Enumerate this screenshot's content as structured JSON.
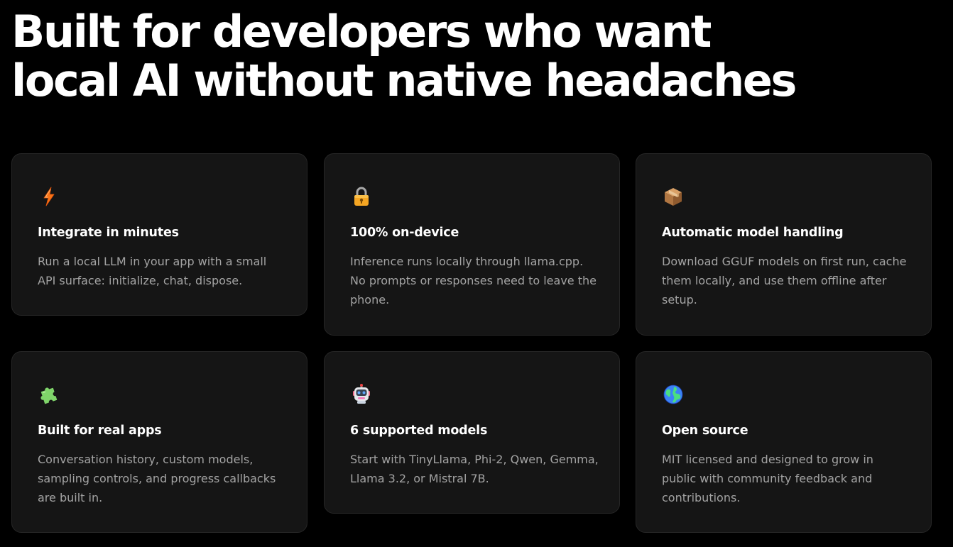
{
  "headline": {
    "line1": "Built for developers who want",
    "line2": "local AI without native headaches"
  },
  "cards": [
    {
      "icon": "lightning-icon",
      "title": "Integrate in minutes",
      "description": "Run a local LLM in your app with a small API surface: initialize, chat, dispose."
    },
    {
      "icon": "lock-icon",
      "title": "100% on-device",
      "description": "Inference runs locally through llama.cpp. No prompts or responses need to leave the phone."
    },
    {
      "icon": "package-icon",
      "title": "Automatic model handling",
      "description": "Download GGUF models on first run, cache them locally, and use them offline after setup."
    },
    {
      "icon": "puzzle-icon",
      "title": "Built for real apps",
      "description": "Conversation history, custom models, sampling controls, and progress callbacks are built in."
    },
    {
      "icon": "robot-icon",
      "title": "6 supported models",
      "description": "Start with TinyLlama, Phi-2, Qwen, Gemma, Llama 3.2, or Mistral 7B."
    },
    {
      "icon": "globe-icon",
      "title": "Open source",
      "description": "MIT licensed and designed to grow in public with community feedback and contributions."
    }
  ]
}
